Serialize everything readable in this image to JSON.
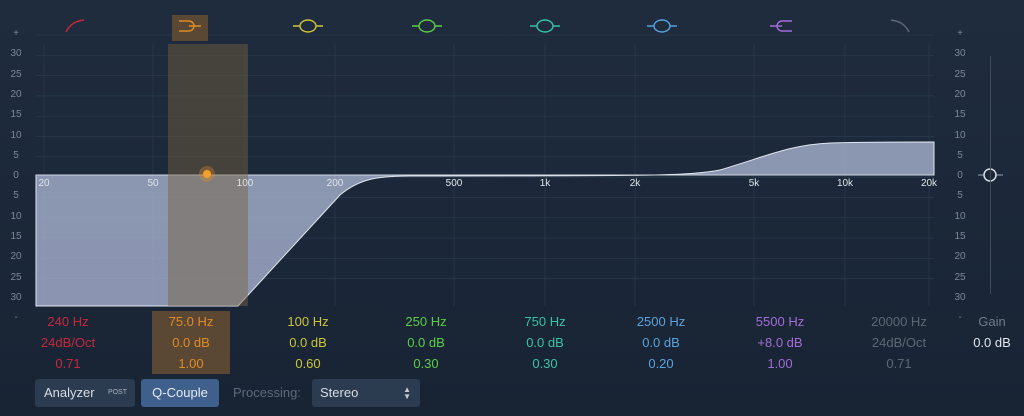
{
  "scale_left": [
    "+",
    "30",
    "25",
    "20",
    "15",
    "10",
    "5",
    "0",
    "5",
    "10",
    "15",
    "20",
    "25",
    "30",
    "-"
  ],
  "scale_right": [
    "+",
    "30",
    "25",
    "20",
    "15",
    "10",
    "5",
    "0",
    "5",
    "10",
    "15",
    "20",
    "25",
    "30",
    "-"
  ],
  "freq_labels": [
    "20",
    "50",
    "100",
    "200",
    "500",
    "1k",
    "2k",
    "5k",
    "10k",
    "20k"
  ],
  "bands": [
    {
      "icon": "lowcut-icon",
      "color": "#c7283a",
      "freq": "240 Hz",
      "gain": "24dB/Oct",
      "q": "0.71",
      "selected": false
    },
    {
      "icon": "lowshelf-icon",
      "color": "#e08a27",
      "freq": "75.0 Hz",
      "gain": "0.0 dB",
      "q": "1.00",
      "selected": true
    },
    {
      "icon": "bell-icon",
      "color": "#cdc43a",
      "freq": "100 Hz",
      "gain": "0.0 dB",
      "q": "0.60",
      "selected": false
    },
    {
      "icon": "bell-icon",
      "color": "#5ccc47",
      "freq": "250 Hz",
      "gain": "0.0 dB",
      "q": "0.30",
      "selected": false
    },
    {
      "icon": "bell-icon",
      "color": "#38c2a3",
      "freq": "750 Hz",
      "gain": "0.0 dB",
      "q": "0.30",
      "selected": false
    },
    {
      "icon": "bell-icon",
      "color": "#5aa2dc",
      "freq": "2500 Hz",
      "gain": "0.0 dB",
      "q": "0.20",
      "selected": false
    },
    {
      "icon": "highshelf-icon",
      "color": "#a36dd9",
      "freq": "5500 Hz",
      "gain": "+8.0 dB",
      "q": "1.00",
      "selected": false
    },
    {
      "icon": "highcut-icon",
      "color": "#5e6774",
      "freq": "20000 Hz",
      "gain": "24dB/Oct",
      "q": "0.71",
      "selected": false
    }
  ],
  "gain": {
    "label": "Gain",
    "value": "0.0 dB"
  },
  "footer": {
    "analyzer_label": "Analyzer",
    "analyzer_badge": "POST",
    "qcouple_label": "Q-Couple",
    "processing_label": "Processing:",
    "processing_value": "Stereo"
  },
  "colors": {
    "background": "#1b2738",
    "curve_fill": "#a8b2d0",
    "selected_band": "#e08a27",
    "grid": "#2a3a4e"
  }
}
